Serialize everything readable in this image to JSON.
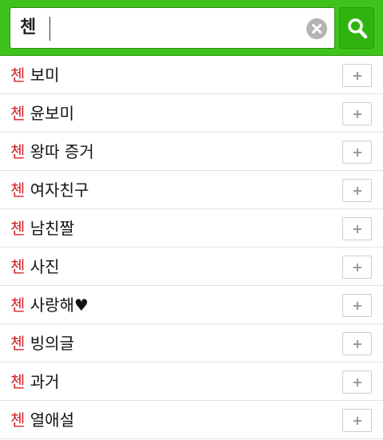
{
  "search": {
    "query": "첸"
  },
  "suggestions": [
    {
      "match": "첸",
      "rest": " 보미"
    },
    {
      "match": "첸",
      "rest": " 윤보미"
    },
    {
      "match": "첸",
      "rest": " 왕따 증거"
    },
    {
      "match": "첸",
      "rest": " 여자친구"
    },
    {
      "match": "첸",
      "rest": " 남친짤"
    },
    {
      "match": "첸",
      "rest": " 사진"
    },
    {
      "match": "첸",
      "rest": " 사랑해♥"
    },
    {
      "match": "첸",
      "rest": " 빙의글"
    },
    {
      "match": "첸",
      "rest": " 과거"
    },
    {
      "match": "첸",
      "rest": " 열애설"
    }
  ],
  "colors": {
    "header_green": "#3fc21b",
    "search_button_green": "#2fb40f",
    "highlight_red": "#d6222a"
  },
  "icons": {
    "clear": "clear-icon",
    "search": "magnifier-icon",
    "add": "plus-icon"
  }
}
